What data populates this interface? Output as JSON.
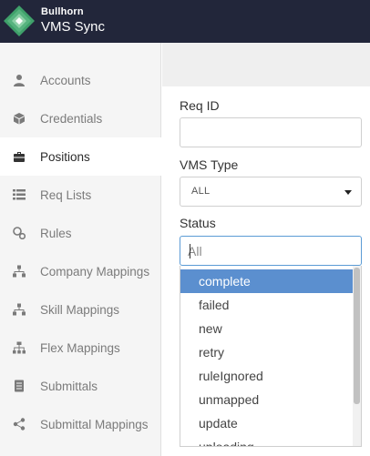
{
  "brand": {
    "company": "Bullhorn",
    "product": "VMS Sync"
  },
  "sidebar": {
    "items": [
      {
        "label": "Accounts",
        "icon": "user-icon"
      },
      {
        "label": "Credentials",
        "icon": "cube-icon"
      },
      {
        "label": "Positions",
        "icon": "briefcase-icon",
        "active": true
      },
      {
        "label": "Req Lists",
        "icon": "list-icon"
      },
      {
        "label": "Rules",
        "icon": "rules-icon"
      },
      {
        "label": "Company Mappings",
        "icon": "sitemap-icon"
      },
      {
        "label": "Skill Mappings",
        "icon": "sitemap-icon"
      },
      {
        "label": "Flex Mappings",
        "icon": "hierarchy-icon"
      },
      {
        "label": "Submittals",
        "icon": "document-icon"
      },
      {
        "label": "Submittal Mappings",
        "icon": "share-icon"
      }
    ]
  },
  "form": {
    "req_id_label": "Req ID",
    "req_id_value": "",
    "vms_type_label": "VMS Type",
    "vms_type_value": "ALL",
    "status_label": "Status",
    "status_placeholder": "All",
    "status_value": ""
  },
  "status_options": [
    "complete",
    "failed",
    "new",
    "retry",
    "ruleIgnored",
    "unmapped",
    "update",
    "uploading"
  ],
  "highlighted_option": "complete",
  "colors": {
    "header_bg": "#22263a",
    "highlight": "#5b8fcf",
    "focus_border": "#5b9bd5"
  }
}
